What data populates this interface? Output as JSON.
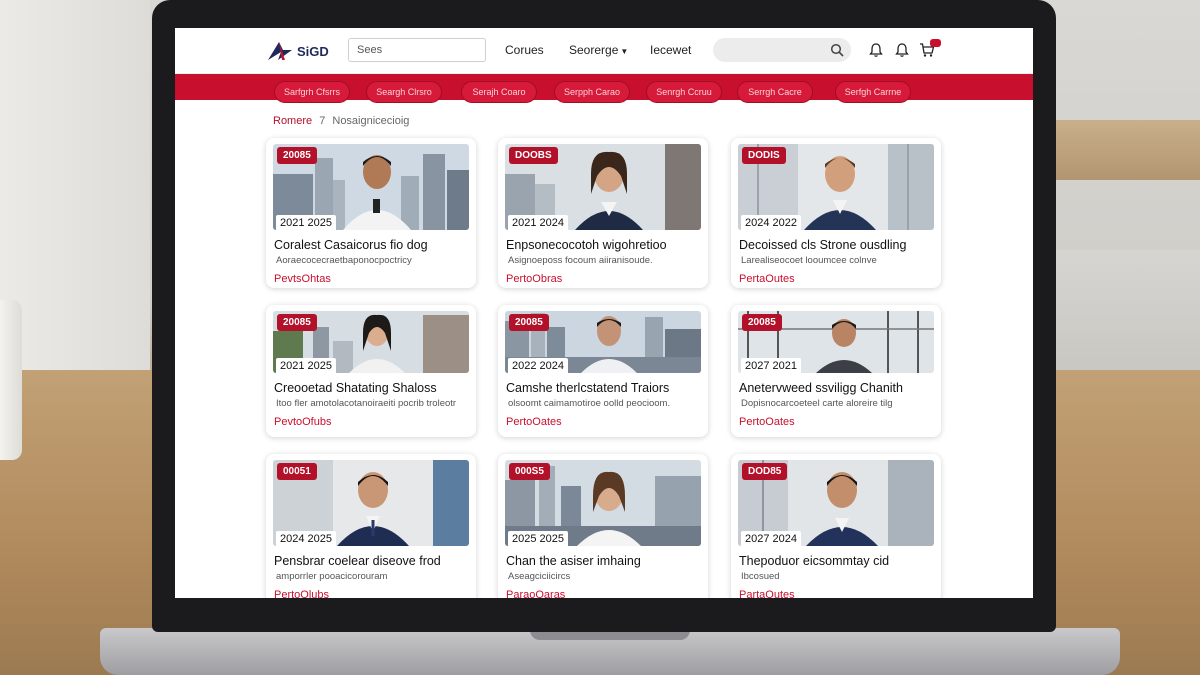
{
  "header": {
    "logo_text": "SiGD",
    "search_value": "Sees",
    "nav": [
      "Corues",
      "Seorerge",
      "Iecewet"
    ],
    "nav_dropdown_index": 1,
    "cart_count": ""
  },
  "categories": [
    "Sarfgrh Cfsrrs",
    "Seargh Clrsro",
    "Serajh Coaro",
    "Serpph Carao",
    "Senrgh Ccruu",
    "Serrgh Cacre",
    "Serfgh Carrne"
  ],
  "breadcrumb": {
    "home": "Romere",
    "separator": "7",
    "current": "Nosaignicecioig"
  },
  "cards": [
    {
      "tag": "20085",
      "years": "2021 2025",
      "title": "Coralest Casaicorus fio dog",
      "subtitle": "Aoraecocecraetbaponocpoctricy",
      "link": "PevtsOhtas"
    },
    {
      "tag": "DOOBS",
      "years": "2021 2024",
      "title": "Enpsonecocotoh wigohretioo",
      "subtitle": "Asignoeposs focoum aiiranisoude.",
      "link": "PertoObras"
    },
    {
      "tag": "DODIS",
      "years": "2024 2022",
      "title": "Decoissed cls Strone ousdling",
      "subtitle": "Larealiseocoet looumcee colnve",
      "link": "PertaOutes"
    },
    {
      "tag": "20085",
      "years": "2021 2025",
      "title": "Creooetad Shatating Shaloss",
      "subtitle": "Itoo fler amotolacotanoiraeiti pocrib troleotr",
      "link": "PevtoOfubs"
    },
    {
      "tag": "20085",
      "years": "2022 2024",
      "title": "Camshe therlcstatend Traiors",
      "subtitle": "olsoomt caimamotiroe oolld peocioom.",
      "link": "PertoOates"
    },
    {
      "tag": "20085",
      "years": "2027 2021",
      "title": "Anetervweed ssviligg Chanith",
      "subtitle": "Dopisnocarcoeteel carte aloreire tilg",
      "link": "PertoOates"
    },
    {
      "tag": "00051",
      "years": "2024 2025",
      "title": "Pensbrar coelear diseove frod",
      "subtitle": "amporrler pooacicorouram",
      "link": "PertoOlubs"
    },
    {
      "tag": "000S5",
      "years": "2025 2025",
      "title": "Chan the asiser imhaing",
      "subtitle": "Aseagciciicircs",
      "link": "ParaoOaras"
    },
    {
      "tag": "DOD85",
      "years": "2027 2024",
      "title": "Thepoduor eicsommtay cid",
      "subtitle": "Ibcosued",
      "link": "PartaOutes"
    }
  ],
  "colors": {
    "brand_red": "#c8102e",
    "logo_navy": "#1f2a5c"
  }
}
